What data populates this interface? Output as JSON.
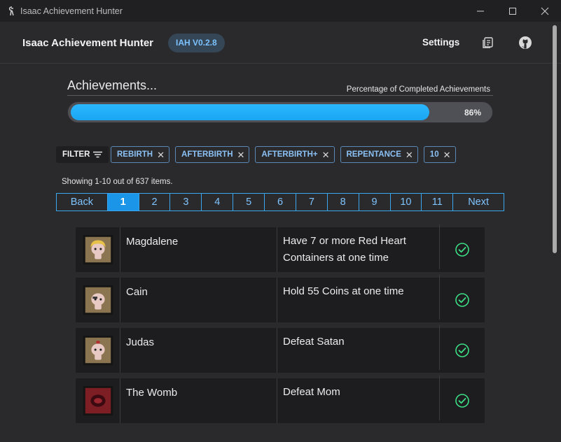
{
  "window": {
    "title": "Isaac Achievement Hunter"
  },
  "header": {
    "brand": "Isaac Achievement Hunter",
    "version": "IAH V0.2.8",
    "settings_label": "Settings",
    "icons": [
      "notes-icon",
      "github-icon"
    ]
  },
  "progress": {
    "heading": "Achievements...",
    "caption": "Percentage of Completed Achievements",
    "percent_label": "86%",
    "value": 0.86,
    "color": "#1aa6f2"
  },
  "filter": {
    "label": "FILTER",
    "chips": [
      "REBIRTH",
      "AFTERBIRTH",
      "AFTERBIRTH+",
      "REPENTANCE",
      "10"
    ]
  },
  "showing": "Showing 1-10 out of 637 items.",
  "pagination": {
    "items": [
      "Back",
      "1",
      "2",
      "3",
      "4",
      "5",
      "6",
      "7",
      "8",
      "9",
      "10",
      "11",
      "Next"
    ],
    "active": "1"
  },
  "achievements": [
    {
      "name": "Magdalene",
      "description": "Have 7 or more Red Heart Containers at one time",
      "icon": "magdalene-portrait",
      "completed": true
    },
    {
      "name": "Cain",
      "description": "Hold 55 Coins at one time",
      "icon": "cain-portrait",
      "completed": true
    },
    {
      "name": "Judas",
      "description": "Defeat Satan",
      "icon": "judas-portrait",
      "completed": true
    },
    {
      "name": "The Womb",
      "description": "Defeat Mom",
      "icon": "womb-portrait",
      "completed": true
    }
  ],
  "colors": {
    "accent": "#1aa6f2",
    "check": "#3ddc84",
    "chip": "#8bc0f3"
  }
}
